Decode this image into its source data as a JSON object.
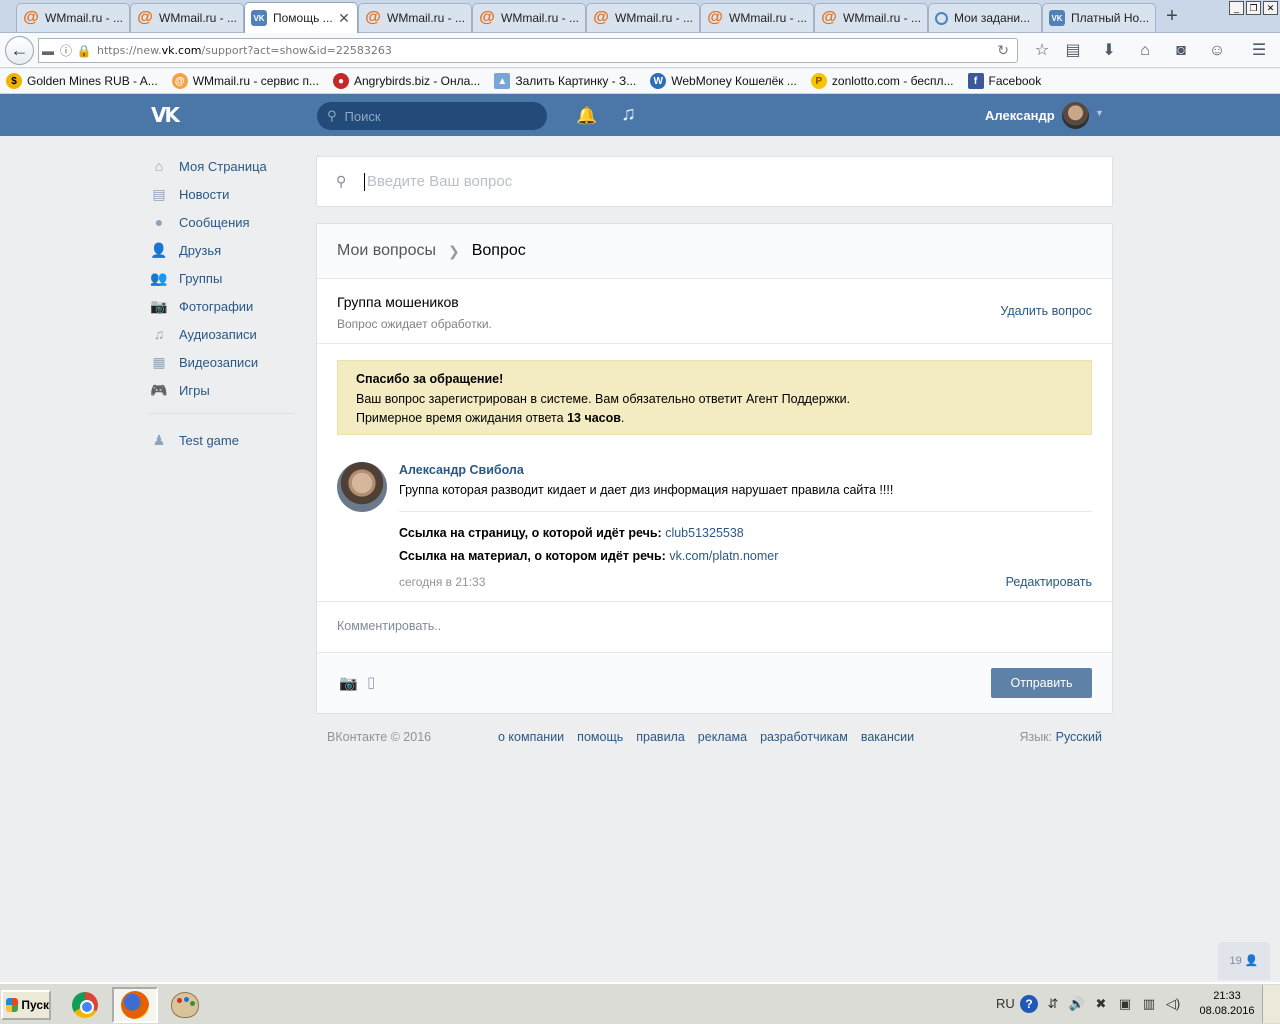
{
  "tabs": [
    {
      "icon": "wmmail-icon",
      "label": "WMmail.ru - ...",
      "active": false
    },
    {
      "icon": "wmmail-icon",
      "label": "WMmail.ru - ...",
      "active": false
    },
    {
      "icon": "vk-icon",
      "label": "Помощь ...",
      "active": true
    },
    {
      "icon": "wmmail-icon",
      "label": "WMmail.ru - ...",
      "active": false
    },
    {
      "icon": "wmmail-icon",
      "label": "WMmail.ru - ...",
      "active": false
    },
    {
      "icon": "wmmail-icon",
      "label": "WMmail.ru - ...",
      "active": false
    },
    {
      "icon": "wmmail-icon",
      "label": "WMmail.ru - ...",
      "active": false
    },
    {
      "icon": "wmmail-icon",
      "label": "WMmail.ru - ...",
      "active": false
    },
    {
      "icon": "target-icon",
      "label": "Мои задани...",
      "active": false
    },
    {
      "icon": "vk-icon",
      "label": "Платный Но...",
      "active": false
    }
  ],
  "browser": {
    "url_prefix": "https://new.",
    "url_domain": "vk.com",
    "url_path": "/support?act=show&id=22583263"
  },
  "bookmarks": [
    {
      "icon": "golden-mines-icon",
      "label": "Golden Mines RUB - A..."
    },
    {
      "icon": "wmmail-icon",
      "label": "WMmail.ru - сервис п..."
    },
    {
      "icon": "angrybirds-icon",
      "label": "Angrybirds.biz - Онла..."
    },
    {
      "icon": "image-upload-icon",
      "label": "Залить Картинку - З..."
    },
    {
      "icon": "webmoney-icon",
      "label": "WebMoney Кошелёк ..."
    },
    {
      "icon": "zonlotto-icon",
      "label": "zonlotto.com - беспл..."
    },
    {
      "icon": "facebook-icon",
      "label": "Facebook"
    }
  ],
  "header": {
    "search_placeholder": "Поиск",
    "user_name": "Александр"
  },
  "nav": [
    {
      "id": "my-page",
      "icon": "home-icon",
      "label": "Моя Страница"
    },
    {
      "id": "news",
      "icon": "news-icon",
      "label": "Новости"
    },
    {
      "id": "messages",
      "icon": "message-icon",
      "label": "Сообщения"
    },
    {
      "id": "friends",
      "icon": "person-icon",
      "label": "Друзья"
    },
    {
      "id": "groups",
      "icon": "group-icon",
      "label": "Группы"
    },
    {
      "id": "photos",
      "icon": "camera-icon",
      "label": "Фотографии"
    },
    {
      "id": "audio",
      "icon": "music-icon",
      "label": "Аудиозаписи"
    },
    {
      "id": "video",
      "icon": "film-icon",
      "label": "Видеозаписи"
    },
    {
      "id": "games",
      "icon": "gamepad-icon",
      "label": "Игры"
    }
  ],
  "nav_apps": [
    {
      "id": "test-game",
      "icon": "app-icon",
      "label": "Test game"
    }
  ],
  "question_search": {
    "placeholder": "Введите Ваш вопрос"
  },
  "breadcrumb": {
    "parent": "Мои вопросы",
    "current": "Вопрос"
  },
  "question": {
    "title": "Группа мошеников",
    "status": "Вопрос ожидает обработки.",
    "delete_label": "Удалить вопрос"
  },
  "notice": {
    "title": "Спасибо за обращение!",
    "line1": "Ваш вопрос зарегистрирован в системе. Вам обязательно ответит Агент Поддержки.",
    "line2_prefix": "Примерное время ожидания ответа ",
    "line2_bold": "13 часов",
    "line2_suffix": "."
  },
  "message": {
    "author": "Александр Свибола",
    "text": "Группа которая разводит кидает и дает диз информация нарушает правила сайта !!!!",
    "link1_label": "Ссылка на страницу, о которой идёт речь:",
    "link1_value": "club51325538",
    "link2_label": "Ссылка на материал, о котором идёт речь:",
    "link2_value": "vk.com/platn.nomer",
    "time": "сегодня в 21:33",
    "edit_label": "Редактировать"
  },
  "comment": {
    "placeholder": "Комментировать..",
    "send_label": "Отправить"
  },
  "footer": {
    "copyright": "ВКонтакте © 2016",
    "links": [
      "о компании",
      "помощь",
      "правила",
      "реклама",
      "разработчикам",
      "вакансии"
    ],
    "lang_label": "Язык:",
    "lang_value": "Русский"
  },
  "online_count": "19",
  "taskbar": {
    "start_label": "Пуск",
    "lang": "RU",
    "time": "21:33",
    "date": "08.08.2016"
  }
}
